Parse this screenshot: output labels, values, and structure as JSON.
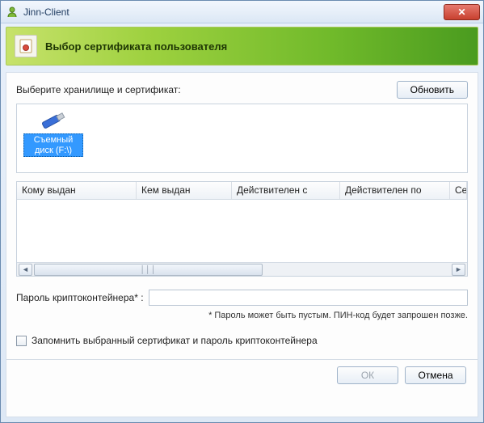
{
  "window": {
    "title": "Jinn-Client"
  },
  "header": {
    "title": "Выбор сертификата пользователя"
  },
  "instructions": "Выберите хранилище и сертификат:",
  "buttons": {
    "refresh": "Обновить",
    "ok": "ОК",
    "cancel": "Отмена",
    "close": "✕"
  },
  "storage": {
    "items": [
      {
        "label": "Съемный диск (F:\\)",
        "selected": true
      }
    ]
  },
  "cert_table": {
    "columns": [
      "Кому выдан",
      "Кем выдан",
      "Действителен с",
      "Действителен по",
      "Се"
    ]
  },
  "password": {
    "label": "Пароль криптоконтейнера* :",
    "value": "",
    "hint": "* Пароль может быть пустым. ПИН-код будет запрошен позже."
  },
  "remember": {
    "label": "Запомнить выбранный сертификат и пароль криптоконтейнера",
    "checked": false
  }
}
